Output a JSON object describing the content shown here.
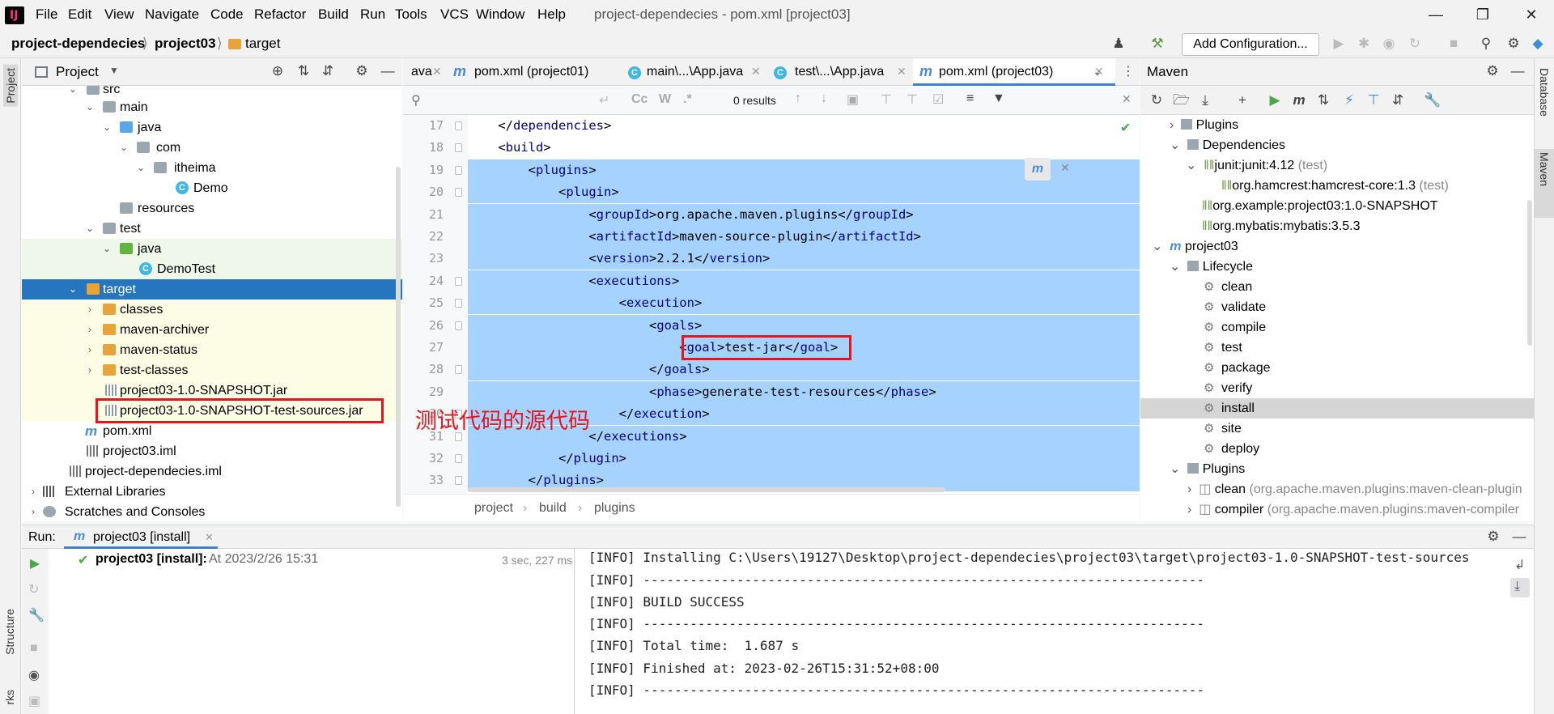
{
  "menu": [
    "File",
    "Edit",
    "View",
    "Navigate",
    "Code",
    "Refactor",
    "Build",
    "Run",
    "Tools",
    "VCS",
    "Window",
    "Help"
  ],
  "window_title": "project-dependecies - pom.xml [project03]",
  "breadcrumb": {
    "root": "project-dependecies",
    "module": "project03",
    "folder": "target"
  },
  "toolbar": {
    "add_config": "Add Configuration..."
  },
  "project_panel": {
    "title": "Project"
  },
  "project_tree": [
    "src",
    "main",
    "java",
    "com",
    "itheima",
    "Demo",
    "resources",
    "test",
    "java",
    "DemoTest",
    "target",
    "classes",
    "maven-archiver",
    "maven-status",
    "test-classes",
    "project03-1.0-SNAPSHOT.jar",
    "project03-1.0-SNAPSHOT-test-sources.jar",
    "pom.xml",
    "project03.iml",
    "project-dependecies.iml",
    "External Libraries",
    "Scratches and Consoles"
  ],
  "annotation": "测试代码的源代码",
  "editor_tabs": [
    "ava",
    "pom.xml (project01)",
    "main\\...\\App.java",
    "test\\...\\App.java",
    "pom.xml (project03)"
  ],
  "find": {
    "results": "0 results",
    "cc": "Cc",
    "w": "W",
    "regex": ".*"
  },
  "line_numbers": [
    "17",
    "18",
    "19",
    "20",
    "21",
    "22",
    "23",
    "24",
    "25",
    "26",
    "27",
    "28",
    "29",
    "30",
    "31",
    "32",
    "33"
  ],
  "code": [
    {
      "indent": "    ",
      "open": "</",
      "tag": "dependencies",
      "close": ">",
      "text": "",
      "end": ""
    },
    {
      "indent": "    ",
      "open": "<",
      "tag": "build",
      "close": ">",
      "text": "",
      "end": ""
    },
    {
      "indent": "        ",
      "open": "<",
      "tag": "plugins",
      "close": ">",
      "text": "",
      "end": ""
    },
    {
      "indent": "            ",
      "open": "<",
      "tag": "plugin",
      "close": ">",
      "text": "",
      "end": ""
    },
    {
      "indent": "                ",
      "open": "<",
      "tag": "groupId",
      "close": ">",
      "text": "org.apache.maven.plugins",
      "end": "groupId"
    },
    {
      "indent": "                ",
      "open": "<",
      "tag": "artifactId",
      "close": ">",
      "text": "maven-source-plugin",
      "end": "artifactId"
    },
    {
      "indent": "                ",
      "open": "<",
      "tag": "version",
      "close": ">",
      "text": "2.2.1",
      "end": "version"
    },
    {
      "indent": "                ",
      "open": "<",
      "tag": "executions",
      "close": ">",
      "text": "",
      "end": ""
    },
    {
      "indent": "                    ",
      "open": "<",
      "tag": "execution",
      "close": ">",
      "text": "",
      "end": ""
    },
    {
      "indent": "                        ",
      "open": "<",
      "tag": "goals",
      "close": ">",
      "text": "",
      "end": ""
    },
    {
      "indent": "                            ",
      "open": "<",
      "tag": "goal",
      "close": ">",
      "text": "test-jar",
      "end": "goal"
    },
    {
      "indent": "                        ",
      "open": "</",
      "tag": "goals",
      "close": ">",
      "text": "",
      "end": ""
    },
    {
      "indent": "                        ",
      "open": "<",
      "tag": "phase",
      "close": ">",
      "text": "generate-test-resources",
      "end": "phase"
    },
    {
      "indent": "                    ",
      "open": "</",
      "tag": "execution",
      "close": ">",
      "text": "",
      "end": ""
    },
    {
      "indent": "                ",
      "open": "</",
      "tag": "executions",
      "close": ">",
      "text": "",
      "end": ""
    },
    {
      "indent": "            ",
      "open": "</",
      "tag": "plugin",
      "close": ">",
      "text": "",
      "end": ""
    },
    {
      "indent": "        ",
      "open": "</",
      "tag": "plugins",
      "close": ">",
      "text": "",
      "end": ""
    }
  ],
  "editor_breadcrumb": [
    "project",
    "build",
    "plugins"
  ],
  "maven": {
    "title": "Maven",
    "rows": [
      "Plugins",
      "Dependencies",
      "junit:junit:4.12",
      "(test)",
      "org.hamcrest:hamcrest-core:1.3",
      "(test)",
      "org.example:project03:1.0-SNAPSHOT",
      "org.mybatis:mybatis:3.5.3",
      "project03",
      "Lifecycle",
      "clean",
      "validate",
      "compile",
      "test",
      "package",
      "verify",
      "install",
      "site",
      "deploy",
      "Plugins",
      "clean",
      "(org.apache.maven.plugins:maven-clean-plugin",
      "compiler",
      "(org.apache.maven.plugins:maven-compiler"
    ]
  },
  "side_labels": {
    "project": "Project",
    "structure": "Structure",
    "bookmarks": "rks",
    "database": "Database",
    "maven": "Maven"
  },
  "run": {
    "label": "Run:",
    "tab": "project03 [install]",
    "item": "project03 [install]:",
    "time": "At 2023/2/26 15:31",
    "duration": "3 sec, 227 ms"
  },
  "console": [
    "[INFO] Installing C:\\Users\\19127\\Desktop\\project-dependecies\\project03\\target\\project03-1.0-SNAPSHOT-test-sources",
    "[INFO] ------------------------------------------------------------------------",
    "[INFO] BUILD SUCCESS",
    "[INFO] ------------------------------------------------------------------------",
    "[INFO] Total time:  1.687 s",
    "[INFO] Finished at: 2023-02-26T15:31:52+08:00",
    "[INFO] ------------------------------------------------------------------------"
  ]
}
